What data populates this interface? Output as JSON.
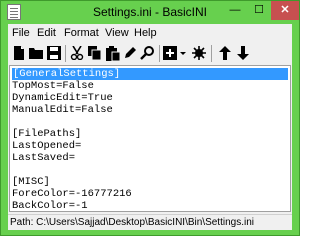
{
  "window": {
    "title": "Settings.ini - BasicINI",
    "minimize_glyph": "—",
    "maximize_glyph": "☐",
    "close_glyph": "✕"
  },
  "menu": [
    "File",
    "Edit",
    "Format",
    "View",
    "Help"
  ],
  "toolbar": {
    "icons": [
      "new-file-icon",
      "open-folder-icon",
      "save-icon",
      "cut-icon",
      "copy-icon",
      "paste-icon",
      "edit-icon",
      "find-icon",
      "add-icon",
      "settings-icon",
      "move-up-icon",
      "move-down-icon"
    ]
  },
  "editor": {
    "lines": [
      "[GeneralSettings]",
      "TopMost=False",
      "DynamicEdit=True",
      "ManualEdit=False",
      "",
      "[FilePaths]",
      "LastOpened=",
      "LastSaved=",
      "",
      "[MISC]",
      "ForeColor=-16777216",
      "BackColor=-1"
    ],
    "selected_line": 0
  },
  "status": {
    "path": "Path:  C:\\Users\\Sajjad\\Desktop\\BasicINI\\Bin\\Settings.ini"
  }
}
